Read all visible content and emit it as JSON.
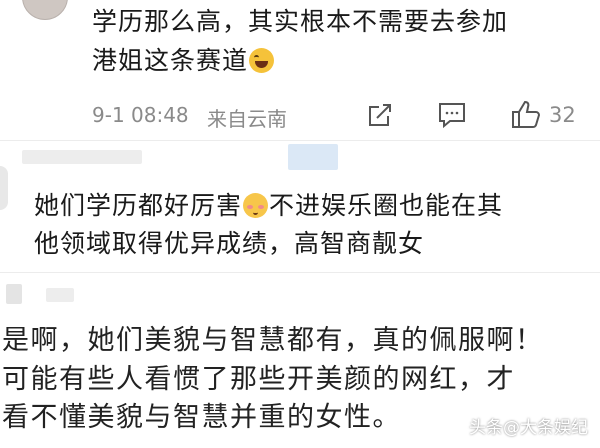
{
  "comment1": {
    "line1": "学历那么高，其实根本不需要去参加",
    "line2": "港姐这条赛道",
    "emoji": "laughing-face-icon",
    "time": "9-1 08:48",
    "location": "来自云南",
    "like_count": "32"
  },
  "comment2": {
    "line1_a": "她们学历都好厉害",
    "emoji": "shy-face-icon",
    "line1_b": "不进娱乐圈也能在其",
    "line2": "他领域取得优异成绩，高智商靓女"
  },
  "comment3": {
    "line1": "是啊，她们美貌与智慧都有，真的佩服啊！",
    "line2": "可能有些人看惯了那些开美颜的网红，才",
    "line3": "看不懂美貌与智慧并重的女性。"
  },
  "watermark": "头条@大条娱纪"
}
